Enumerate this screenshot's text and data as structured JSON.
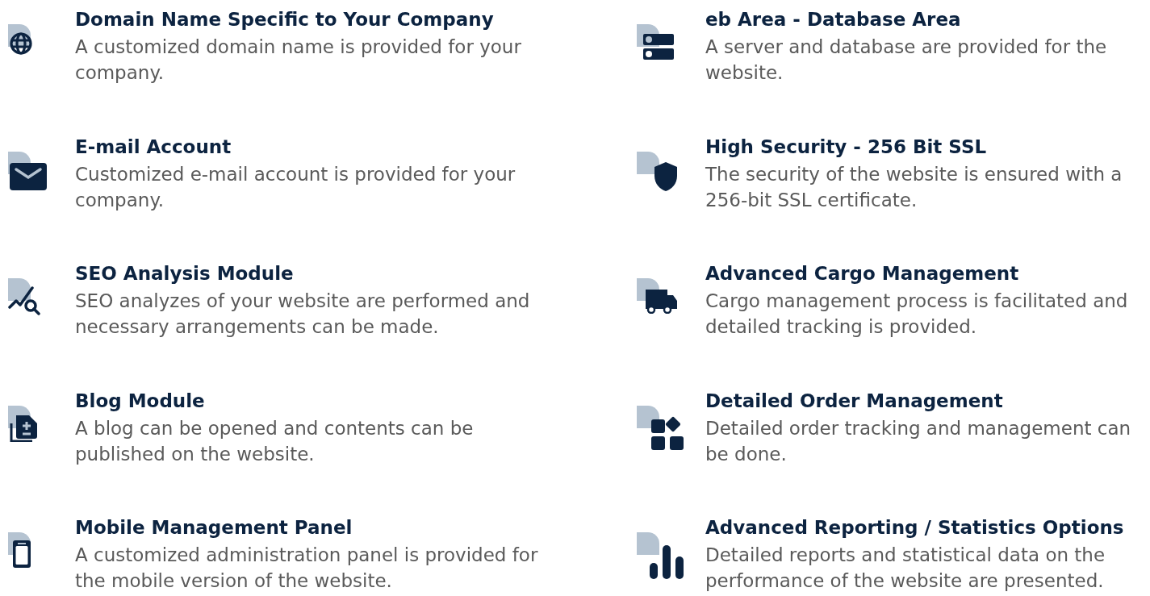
{
  "columns": [
    {
      "items": [
        {
          "title": "Domain Name Specific to Your Company",
          "description": "A customized domain name is provided for your company."
        },
        {
          "title": "E-mail Account",
          "description": "Customized e-mail account is provided for your company."
        },
        {
          "title": "SEO Analysis Module",
          "description": "SEO analyzes of your website are performed and necessary arrangements can be made."
        },
        {
          "title": "Blog Module",
          "description": "A blog can be opened and contents can be published on the website."
        },
        {
          "title": "Mobile Management Panel",
          "description": "A customized administration panel is provided for the mobile version of the website."
        }
      ]
    },
    {
      "items": [
        {
          "title": "eb Area - Database Area",
          "description": "A server and database are provided for the website."
        },
        {
          "title": "High Security - 256 Bit SSL",
          "description": "The security of the website is ensured with a 256-bit SSL certificate."
        },
        {
          "title": "Advanced Cargo Management",
          "description": "Cargo management process is facilitated and detailed tracking is provided."
        },
        {
          "title": "Detailed Order Management",
          "description": "Detailed order tracking and management can be done."
        },
        {
          "title": "Advanced Reporting / Statistics Options",
          "description": "Detailed reports and statistical data on the performance of the website are presented."
        }
      ]
    }
  ]
}
